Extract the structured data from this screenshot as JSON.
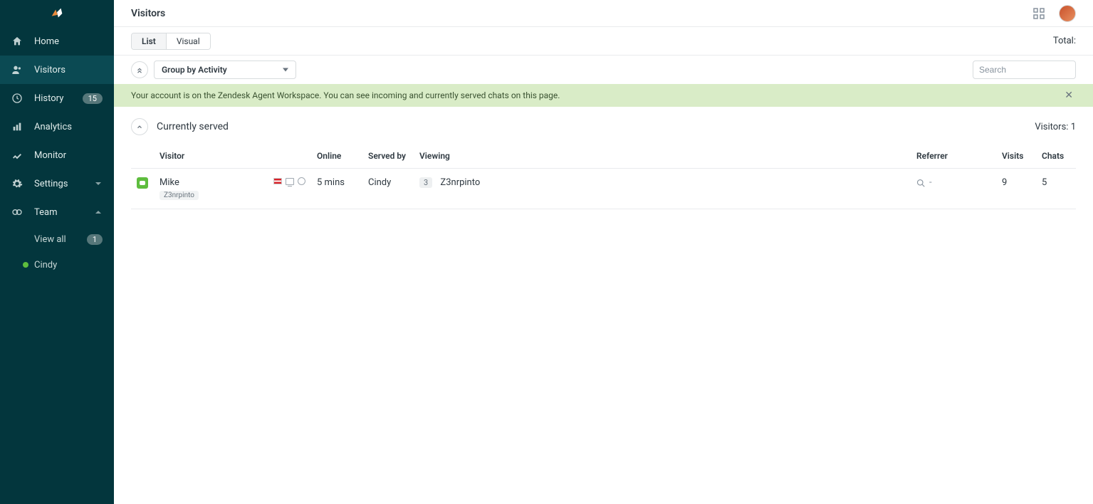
{
  "page": {
    "title": "Visitors",
    "total_label": "Total:"
  },
  "sidebar": {
    "items": [
      {
        "label": "Home"
      },
      {
        "label": "Visitors"
      },
      {
        "label": "History",
        "badge": "15"
      },
      {
        "label": "Analytics"
      },
      {
        "label": "Monitor"
      },
      {
        "label": "Settings"
      },
      {
        "label": "Team"
      }
    ],
    "team": {
      "view_all_label": "View all",
      "view_all_badge": "1",
      "members": [
        {
          "name": "Cindy"
        }
      ]
    }
  },
  "tabs": {
    "list": "List",
    "visual": "Visual"
  },
  "groupby": {
    "label": "Group by Activity"
  },
  "search": {
    "placeholder": "Search"
  },
  "banner": {
    "text": "Your account is on the Zendesk Agent Workspace. You can see incoming and currently served chats on this page."
  },
  "section": {
    "title": "Currently served",
    "count_label": "Visitors:",
    "count_value": "1"
  },
  "table": {
    "headers": {
      "visitor": "Visitor",
      "online": "Online",
      "served_by": "Served by",
      "viewing": "Viewing",
      "referrer": "Referrer",
      "visits": "Visits",
      "chats": "Chats"
    },
    "rows": [
      {
        "name": "Mike",
        "tag": "Z3nrpinto",
        "online": "5 mins",
        "served_by": "Cindy",
        "viewing_count": "3",
        "viewing_page": "Z3nrpinto",
        "referrer": "-",
        "visits": "9",
        "chats": "5"
      }
    ]
  }
}
